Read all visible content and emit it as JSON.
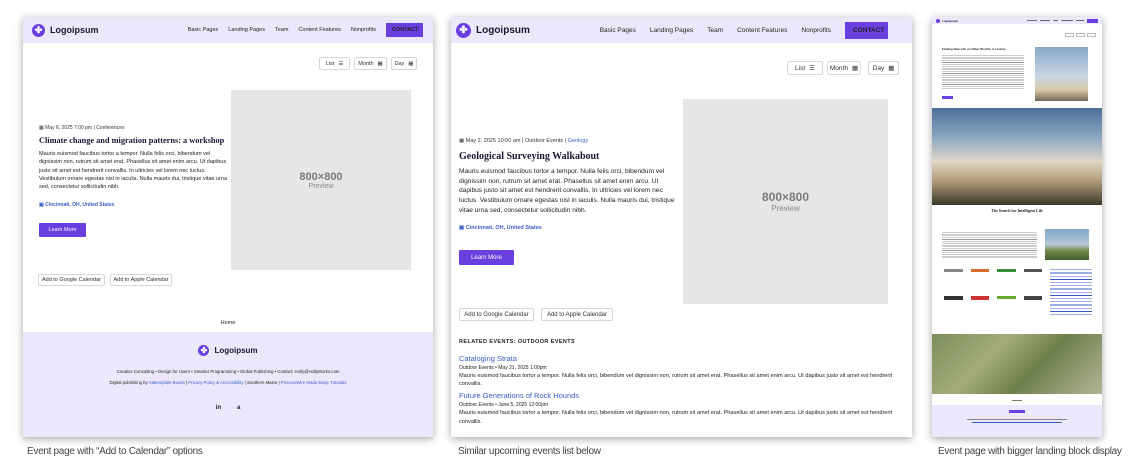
{
  "shared": {
    "logo_text": "Logoipsum",
    "logo_glyph": "✤",
    "nav": [
      "Basic Pages",
      "Landing Pages",
      "Team",
      "Content Features",
      "Nonprofits"
    ],
    "contact": "CONTACT",
    "view_buttons": [
      {
        "label": "List",
        "icon": "list-icon"
      },
      {
        "label": "Month",
        "icon": "calendar-icon"
      },
      {
        "label": "Day",
        "icon": "calendar-icon"
      }
    ],
    "placeholder_size": "800×800",
    "placeholder_label": "Preview",
    "learn_more": "Learn More",
    "cal_google": "Add to Google Calendar",
    "cal_apple": "Add to Apple Calendar",
    "location": "Cincinnati, OH, United States",
    "body_text": "Mauris euismod faucibus tortor a tempor. Nulla felis orci, bibendum vel dignissim non, rutrum sit amet erat. Phasellus sit amet enim arcu. Ut dapibus justo sit amet est hendrerit convallis. In ultricies vel lorem nec luctus. Vestibulum ornare egestas nisl in iaculis. Nulla mauris dui, tristique vitae urna sed, consectetur sollicitudin nibh."
  },
  "panel1": {
    "meta_date": "May 6, 2025 7:00 pm",
    "meta_cat": "Conferences",
    "title": "Climate change and migration patterns: a workshop",
    "breadcrumb": "Home",
    "footer_line1": "Creative Consulting • Design for Users • Smarter Programming • Global Publishing • Contact: Holly@HollyWorks.com",
    "footer_line2_a": "Digital publishing by",
    "footer_line2_link1": "Saltemplate Books",
    "footer_line2_sep": "|",
    "footer_line2_link2": "Privacy Policy & Accessibility",
    "footer_line2_b": "| Southern Maine |",
    "footer_line2_link3": "ProcessWire Made Easy: Tutorials",
    "social": [
      "in",
      "a"
    ],
    "caption": "Event page with “Add to Calendar” options"
  },
  "panel2": {
    "meta_date": "May 2, 2025 10:00 am",
    "meta_cat": "Outdoor Events",
    "meta_tag": "Geology",
    "title": "Geological Surveying Walkabout",
    "related_heading": "RELATED EVENTS: OUTDOOR EVENTS",
    "related": [
      {
        "title": "Cataloging Strata",
        "meta": "Outdoor Events • May 21, 2025 1:00pm",
        "text": "Mauris euismod faucibus tortor a tempor. Nulla felis orci, bibendum vel dignissim non, rutrum sit amet erat. Phasellus sit amet enim arcu. Ut dapibus justo sit amet est hendrerit convallis."
      },
      {
        "title": "Future Generations of Rock Hounds",
        "meta": "Outdoor Events • June 5, 2025 12:00pm",
        "text": "Mauris euismod faucibus tortor a tempor. Nulla felis orci, bibendum vel dignissim non, rutrum sit amet erat. Phasellus sit amet enim arcu. Ut dapibus justo sit amet est hendrerit convallis."
      }
    ],
    "caption": "Similar upcoming events list below"
  },
  "panel3": {
    "heading": "Finding New Life on Other Worlds: A Lecture",
    "section_title": "The Search for Intelligent Life",
    "caption": "Event page with bigger landing block display"
  },
  "colors": {
    "accent": "#6a3fe0",
    "nav_bg": "#ece8fb",
    "link": "#3a5cc7"
  }
}
